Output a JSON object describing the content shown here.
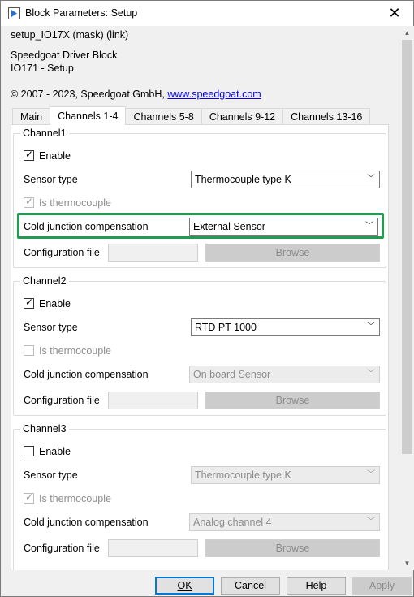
{
  "window": {
    "title": "Block Parameters: Setup",
    "close_glyph": "✕"
  },
  "header": {
    "mask_line": "setup_IO17X (mask) (link)",
    "block_name": "Speedgoat Driver Block",
    "block_desc": "IO171 - Setup",
    "copyright": "© 2007 - 2023, Speedgoat GmbH, ",
    "link": "www.speedgoat.com"
  },
  "tabs": [
    "Main",
    "Channels 1-4",
    "Channels 5-8",
    "Channels 9-12",
    "Channels 13-16"
  ],
  "active_tab": "Channels 1-4",
  "labels": {
    "enable": "Enable",
    "sensor_type": "Sensor type",
    "is_thermocouple": "Is thermocouple",
    "cjc": "Cold junction compensation",
    "config_file": "Configuration file",
    "browse": "Browse"
  },
  "channels": [
    {
      "title": "Channel1",
      "enable_checked": true,
      "sensor_type": "Thermocouple type K",
      "sensor_enabled": true,
      "is_thermocouple_checked": true,
      "cjc": "External Sensor",
      "cjc_enabled": true,
      "cjc_highlighted": true
    },
    {
      "title": "Channel2",
      "enable_checked": true,
      "sensor_type": "RTD PT 1000",
      "sensor_enabled": true,
      "is_thermocouple_checked": false,
      "cjc": "On board Sensor",
      "cjc_enabled": false
    },
    {
      "title": "Channel3",
      "enable_checked": false,
      "sensor_type": "Thermocouple type K",
      "sensor_enabled": false,
      "is_thermocouple_checked": true,
      "cjc": "Analog channel 4",
      "cjc_enabled": false
    }
  ],
  "buttons": {
    "ok": "OK",
    "cancel": "Cancel",
    "help": "Help",
    "apply": "Apply"
  },
  "colors": {
    "highlight": "#1e9e4e",
    "link": "#0000ee",
    "default_button_border": "#0078d7"
  }
}
